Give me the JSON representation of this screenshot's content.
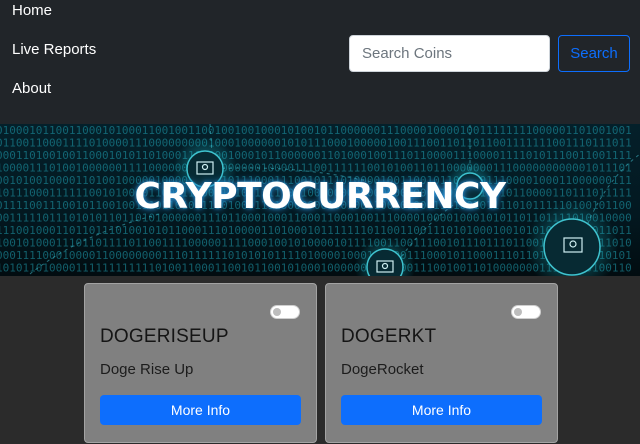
{
  "nav": {
    "links": [
      "Home",
      "Live Reports",
      "About"
    ]
  },
  "search": {
    "placeholder": "Search Coins",
    "value": "",
    "button_label": "Search"
  },
  "hero": {
    "title": "CRYPTOCURRENCY"
  },
  "coins": [
    {
      "symbol": "DOGERISEUP",
      "name": "Doge Rise Up",
      "toggle_on": false,
      "button_label": "More Info"
    },
    {
      "symbol": "DOGERKT",
      "name": "DogeRocket",
      "toggle_on": false,
      "button_label": "More Info"
    }
  ],
  "colors": {
    "accent": "#0d6efd",
    "navbar_bg": "#212529",
    "page_bg": "#2b2b2b",
    "card_bg": "#808080",
    "hero_glow": "#1ec8d8"
  }
}
